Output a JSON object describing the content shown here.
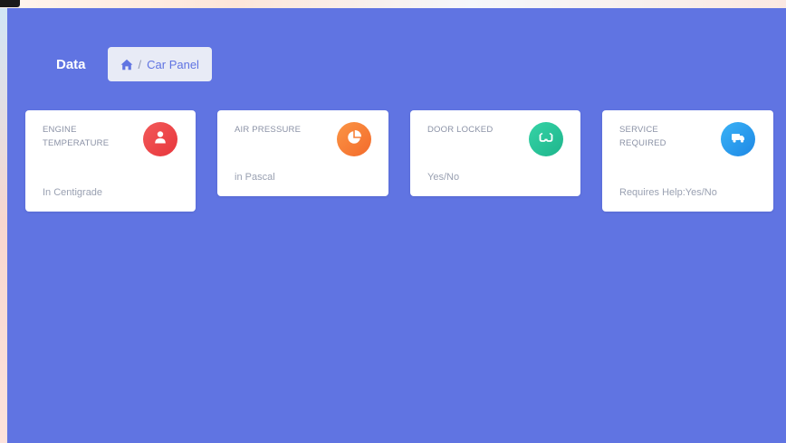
{
  "header": {
    "title": "Data",
    "breadcrumb": {
      "home_icon": "home-icon",
      "separator": "/",
      "current": "Car Panel"
    }
  },
  "cards": [
    {
      "label_line1": "ENGINE",
      "label_line2": "TEMPERATURE",
      "subtitle": "In Centigrade",
      "icon": "user-icon",
      "color": "#e8363c"
    },
    {
      "label_line1": "AIR PRESSURE",
      "label_line2": "",
      "subtitle": "in Pascal",
      "icon": "pie-chart-icon",
      "color": "#f36a2b"
    },
    {
      "label_line1": "DOOR LOCKED",
      "label_line2": "",
      "subtitle": "Yes/No",
      "icon": "glasses-icon",
      "color": "#1fb58c"
    },
    {
      "label_line1": "SERVICE",
      "label_line2": "REQUIRED",
      "subtitle": "Requires Help:Yes/No",
      "icon": "truck-icon",
      "color": "#1e88e5"
    }
  ],
  "colors": {
    "panel_bg": "#6074e2",
    "card_bg": "#ffffff",
    "breadcrumb_bg": "#e8ebf6"
  }
}
